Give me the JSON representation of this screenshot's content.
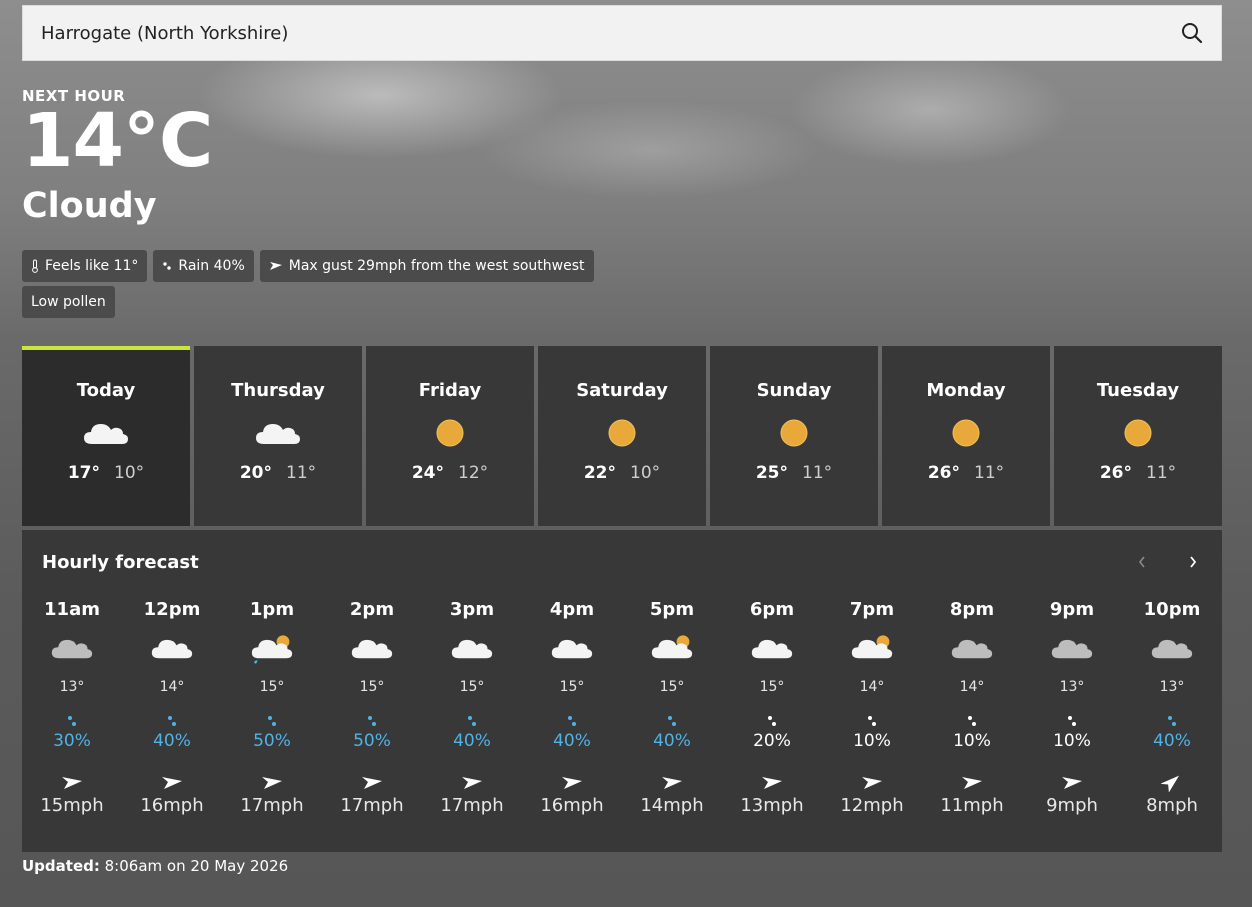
{
  "search": {
    "value": "Harrogate (North Yorkshire)"
  },
  "current": {
    "label": "NEXT HOUR",
    "temperature": "14°C",
    "condition": "Cloudy",
    "chips": {
      "feels_like": "Feels like 11°",
      "rain": "Rain 40%",
      "gust": "Max gust 29mph from the west southwest",
      "pollen": "Low pollen"
    }
  },
  "days": [
    {
      "name": "Today",
      "icon": "cloud-icon",
      "max": "17°",
      "min": "10°"
    },
    {
      "name": "Thursday",
      "icon": "cloud-icon",
      "max": "20°",
      "min": "11°"
    },
    {
      "name": "Friday",
      "icon": "sun-icon",
      "max": "24°",
      "min": "12°"
    },
    {
      "name": "Saturday",
      "icon": "sun-icon",
      "max": "22°",
      "min": "10°"
    },
    {
      "name": "Sunday",
      "icon": "sun-icon",
      "max": "25°",
      "min": "11°"
    },
    {
      "name": "Monday",
      "icon": "sun-icon",
      "max": "26°",
      "min": "11°"
    },
    {
      "name": "Tuesday",
      "icon": "sun-icon",
      "max": "26°",
      "min": "11°"
    }
  ],
  "hourly": {
    "title": "Hourly forecast",
    "hours": [
      {
        "time": "11am",
        "icon": "grey-cloud-icon",
        "temp": "13°",
        "rain": "30%",
        "wet": true,
        "wind": "15mph",
        "dir": "west-southwest"
      },
      {
        "time": "12pm",
        "icon": "cloud-icon",
        "temp": "14°",
        "rain": "40%",
        "wet": true,
        "wind": "16mph",
        "dir": "west-southwest"
      },
      {
        "time": "1pm",
        "icon": "sun-cloud-rain-icon",
        "temp": "15°",
        "rain": "50%",
        "wet": true,
        "wind": "17mph",
        "dir": "west-southwest"
      },
      {
        "time": "2pm",
        "icon": "cloud-icon",
        "temp": "15°",
        "rain": "50%",
        "wet": true,
        "wind": "17mph",
        "dir": "west-southwest"
      },
      {
        "time": "3pm",
        "icon": "cloud-icon",
        "temp": "15°",
        "rain": "40%",
        "wet": true,
        "wind": "17mph",
        "dir": "west-southwest"
      },
      {
        "time": "4pm",
        "icon": "cloud-icon",
        "temp": "15°",
        "rain": "40%",
        "wet": true,
        "wind": "16mph",
        "dir": "west-southwest"
      },
      {
        "time": "5pm",
        "icon": "sun-cloud-icon",
        "temp": "15°",
        "rain": "40%",
        "wet": true,
        "wind": "14mph",
        "dir": "west-southwest"
      },
      {
        "time": "6pm",
        "icon": "cloud-icon",
        "temp": "15°",
        "rain": "20%",
        "wet": false,
        "wind": "13mph",
        "dir": "west-southwest"
      },
      {
        "time": "7pm",
        "icon": "sun-cloud-icon",
        "temp": "14°",
        "rain": "10%",
        "wet": false,
        "wind": "12mph",
        "dir": "west-southwest"
      },
      {
        "time": "8pm",
        "icon": "grey-cloud-icon",
        "temp": "14°",
        "rain": "10%",
        "wet": false,
        "wind": "11mph",
        "dir": "west-southwest"
      },
      {
        "time": "9pm",
        "icon": "grey-cloud-icon",
        "temp": "13°",
        "rain": "10%",
        "wet": false,
        "wind": "9mph",
        "dir": "west-southwest"
      },
      {
        "time": "10pm",
        "icon": "grey-cloud-icon",
        "temp": "13°",
        "rain": "40%",
        "wet": true,
        "wind": "8mph",
        "dir": "southwest"
      }
    ]
  },
  "updated": {
    "label": "Updated:",
    "text": "8:06am on 20 May 2026"
  },
  "colors": {
    "accent": "#c8e63c",
    "rain": "#4fb3e6",
    "sun": "#e8a93a"
  }
}
